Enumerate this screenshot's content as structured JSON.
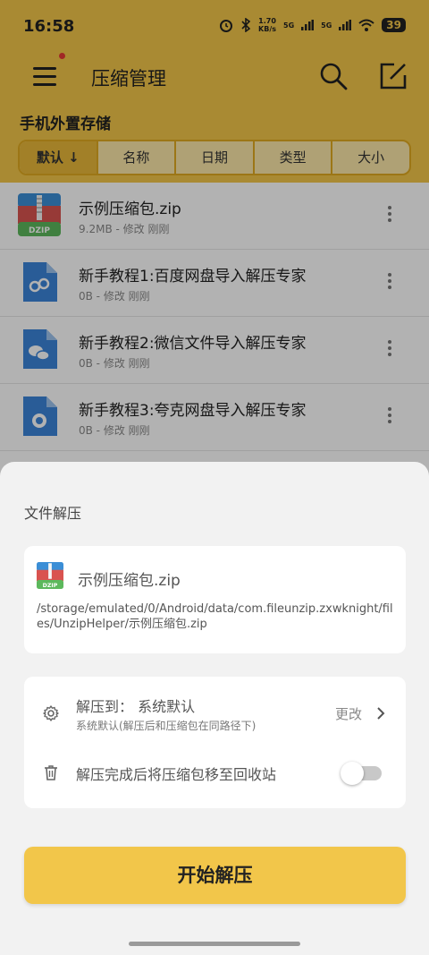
{
  "status_bar": {
    "time": "16:58",
    "net_speed": "1.70",
    "net_speed_unit": "KB/s",
    "sig1": "5G",
    "sig2": "5G",
    "battery": "39"
  },
  "toolbar": {
    "title": "压缩管理"
  },
  "storage": {
    "title": "手机外置存储"
  },
  "sort": {
    "tabs": [
      "默认 ↓",
      "名称",
      "日期",
      "类型",
      "大小"
    ]
  },
  "files": [
    {
      "name": "示例压缩包.zip",
      "meta": "9.2MB - 修改 刚刚",
      "icon": "dzip-icon"
    },
    {
      "name": "新手教程1:百度网盘导入解压专家",
      "meta": "0B - 修改 刚刚",
      "icon": "baidu-doc-icon"
    },
    {
      "name": "新手教程2:微信文件导入解压专家",
      "meta": "0B - 修改 刚刚",
      "icon": "wechat-doc-icon"
    },
    {
      "name": "新手教程3:夸克网盘导入解压专家",
      "meta": "0B - 修改 刚刚",
      "icon": "quark-doc-icon"
    }
  ],
  "sheet": {
    "title": "文件解压",
    "file_name": "示例压缩包.zip",
    "file_path": "/storage/emulated/0/Android/data/com.fileunzip.zxwknight/files/UnzipHelper/示例压缩包.zip",
    "extract_to_label": "解压到：  系统默认",
    "extract_to_sub": "系统默认(解压后和压缩包在同路径下)",
    "change_label": "更改",
    "recycle_label": "解压完成后将压缩包移至回收站",
    "recycle_enabled": false,
    "start_button": "开始解压"
  },
  "colors": {
    "accent": "#f2c64a",
    "sheet_bg": "#f2f2f2",
    "card_bg": "#ffffff"
  }
}
